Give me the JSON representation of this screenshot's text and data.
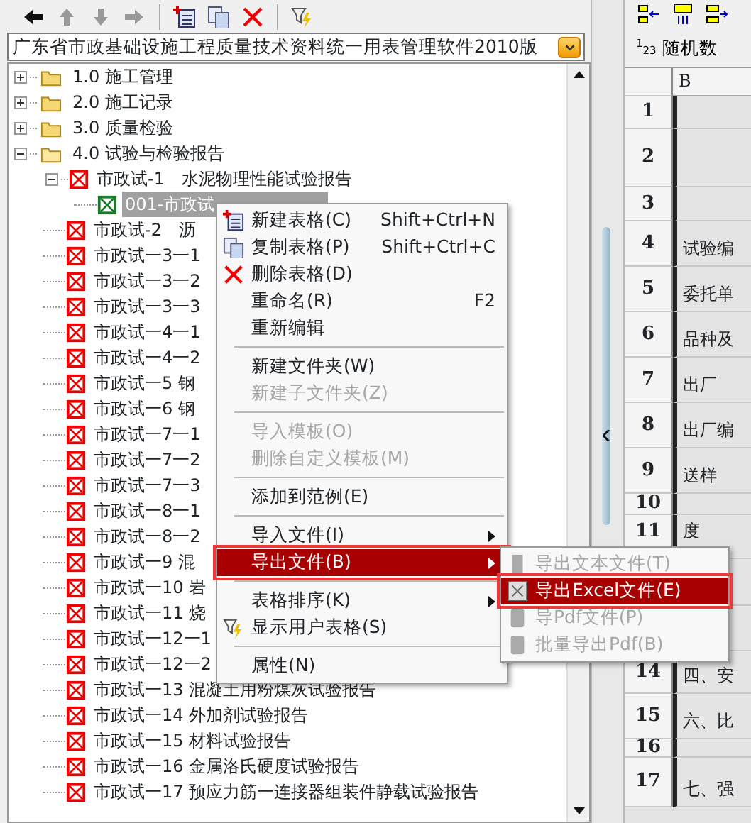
{
  "toolbar": [
    {
      "kind": "back",
      "disabled": false
    },
    {
      "kind": "up",
      "disabled": true
    },
    {
      "kind": "down",
      "disabled": true
    },
    {
      "kind": "forward",
      "disabled": true
    },
    {
      "kind": "new"
    },
    {
      "kind": "copy"
    },
    {
      "kind": "delete"
    },
    {
      "kind": "filter"
    }
  ],
  "template_selector": {
    "value": "广东省市政基础设施工程质量技术资料统一用表管理软件2010版"
  },
  "tree": [
    {
      "label": "1.0 施工管理",
      "kind": "folder",
      "expanded": false,
      "selected": false
    },
    {
      "label": "2.0 施工记录",
      "kind": "folder",
      "expanded": false,
      "selected": false
    },
    {
      "label": "3.0 质量检验",
      "kind": "folder",
      "expanded": false,
      "selected": false
    },
    {
      "label": "4.0 试验与检验报告",
      "kind": "folder",
      "expanded": true,
      "selected": false,
      "children": [
        {
          "label": "市政试-1　水泥物理性能试验报告",
          "kind": "form",
          "expanded": true,
          "selected": false,
          "children": [
            {
              "label": "001-市政试",
              "kind": "sheet",
              "selected": true
            }
          ]
        },
        {
          "label": "市政试-2　沥",
          "kind": "form",
          "selected": false
        },
        {
          "label": "市政试一3一1",
          "kind": "form",
          "selected": false
        },
        {
          "label": "市政试一3一2",
          "kind": "form",
          "selected": false
        },
        {
          "label": "市政试一3一3",
          "kind": "form",
          "selected": false
        },
        {
          "label": "市政试一4一1",
          "kind": "form",
          "selected": false
        },
        {
          "label": "市政试一4一2",
          "kind": "form",
          "selected": false
        },
        {
          "label": "市政试一5 钢",
          "kind": "form",
          "selected": false
        },
        {
          "label": "市政试一6 钢",
          "kind": "form",
          "selected": false
        },
        {
          "label": "市政试一7一1",
          "kind": "form",
          "selected": false
        },
        {
          "label": "市政试一7一2",
          "kind": "form",
          "selected": false
        },
        {
          "label": "市政试一7一3",
          "kind": "form",
          "selected": false
        },
        {
          "label": "市政试一8一1",
          "kind": "form",
          "selected": false
        },
        {
          "label": "市政试一8一2",
          "kind": "form",
          "selected": false
        },
        {
          "label": "市政试一9 混",
          "kind": "form",
          "selected": false
        },
        {
          "label": "市政试一10 岩",
          "kind": "form",
          "selected": false
        },
        {
          "label": "市政试一11 烧",
          "kind": "form",
          "selected": false
        },
        {
          "label": "市政试一12一1",
          "kind": "form",
          "selected": false
        },
        {
          "label": "市政试一12一2",
          "kind": "form",
          "selected": false
        },
        {
          "label": "市政试一13 混凝土用粉煤灰试验报告",
          "kind": "form",
          "selected": false
        },
        {
          "label": "市政试一14 外加剂试验报告",
          "kind": "form",
          "selected": false
        },
        {
          "label": "市政试一15 材料试验报告",
          "kind": "form",
          "selected": false
        },
        {
          "label": "市政试一16 金属洛氏硬度试验报告",
          "kind": "form",
          "selected": false
        },
        {
          "label": "市政试一17 预应力筋一连接器组装件静载试验报告",
          "kind": "form",
          "selected": false
        }
      ]
    }
  ],
  "context_menu": {
    "items": [
      {
        "kind": "create",
        "label": "新建表格(C)",
        "shortcut": "Shift+Ctrl+N",
        "disabled": false,
        "selected": false
      },
      {
        "kind": "duplicate",
        "label": "复制表格(P)",
        "shortcut": "Shift+Ctrl+C",
        "disabled": false,
        "selected": false
      },
      {
        "kind": "remove",
        "label": "删除表格(D)",
        "disabled": false,
        "selected": false
      },
      {
        "kind": "plain",
        "label": "重命名(R)",
        "shortcut": "F2",
        "disabled": false,
        "selected": false
      },
      {
        "kind": "plain",
        "label": "重新编辑",
        "disabled": false,
        "selected": false
      },
      {
        "kind": "separator"
      },
      {
        "kind": "plain",
        "label": "新建文件夹(W)",
        "disabled": false,
        "selected": false
      },
      {
        "kind": "plain",
        "label": "新建子文件夹(Z)",
        "disabled": true,
        "selected": false
      },
      {
        "kind": "separator"
      },
      {
        "kind": "plain",
        "label": "导入模板(O)",
        "disabled": true,
        "selected": false
      },
      {
        "kind": "plain",
        "label": "删除自定义模板(M)",
        "disabled": true,
        "selected": false
      },
      {
        "kind": "separator"
      },
      {
        "kind": "plain",
        "label": "添加到范例(E)",
        "disabled": false,
        "selected": false
      },
      {
        "kind": "separator"
      },
      {
        "kind": "plain",
        "label": "导入文件(I)",
        "submenu": true,
        "disabled": false,
        "selected": false
      },
      {
        "kind": "plain",
        "label": "导出文件(B)",
        "submenu": true,
        "disabled": false,
        "selected": true,
        "annotated": true
      },
      {
        "kind": "separator"
      },
      {
        "kind": "plain",
        "label": "表格排序(K)",
        "submenu": true,
        "disabled": false,
        "selected": false
      },
      {
        "kind": "filter",
        "label": "显示用户表格(S)",
        "disabled": false,
        "selected": false
      },
      {
        "kind": "separator"
      },
      {
        "kind": "plain",
        "label": "属性(N)",
        "disabled": false,
        "selected": false
      }
    ]
  },
  "submenu": {
    "items": [
      {
        "kind": "text",
        "label": "导出文本文件(T)",
        "disabled": true,
        "selected": false
      },
      {
        "kind": "spreadsheet",
        "label": "导出Excel文件(E)",
        "disabled": false,
        "selected": true,
        "annotated": true
      },
      {
        "kind": "pdf",
        "label": "导Pdf文件(P)",
        "disabled": true,
        "selected": false
      },
      {
        "kind": "pdf",
        "label": "批量导出Pdf(B)",
        "disabled": true,
        "selected": false
      }
    ]
  },
  "right_toolbar": [
    {
      "kind": "insert-left"
    },
    {
      "kind": "insert-row"
    },
    {
      "kind": "insert-right"
    }
  ],
  "random_button": {
    "badge": "$^{1}$$_{23}$",
    "label": "随机数"
  },
  "sheet": {
    "columns": [
      "B"
    ],
    "rows": [
      {
        "number": "1"
      },
      {
        "number": "2"
      },
      {
        "number": "3"
      },
      {
        "number": "4",
        "text": "试验编"
      },
      {
        "number": "5",
        "text": "委托单"
      },
      {
        "number": "6",
        "text": "品种及"
      },
      {
        "number": "7",
        "text": "出厂"
      },
      {
        "number": "8",
        "text": "出厂编"
      },
      {
        "number": "9",
        "text": "送样"
      },
      {
        "number": "10"
      },
      {
        "number": "11",
        "text": "度"
      },
      {},
      {},
      {
        "number": "14",
        "text": "四、安"
      },
      {
        "number": "15",
        "text": "六、比"
      },
      {
        "number": "16"
      },
      {
        "number": "17",
        "text": "七、强"
      }
    ]
  }
}
